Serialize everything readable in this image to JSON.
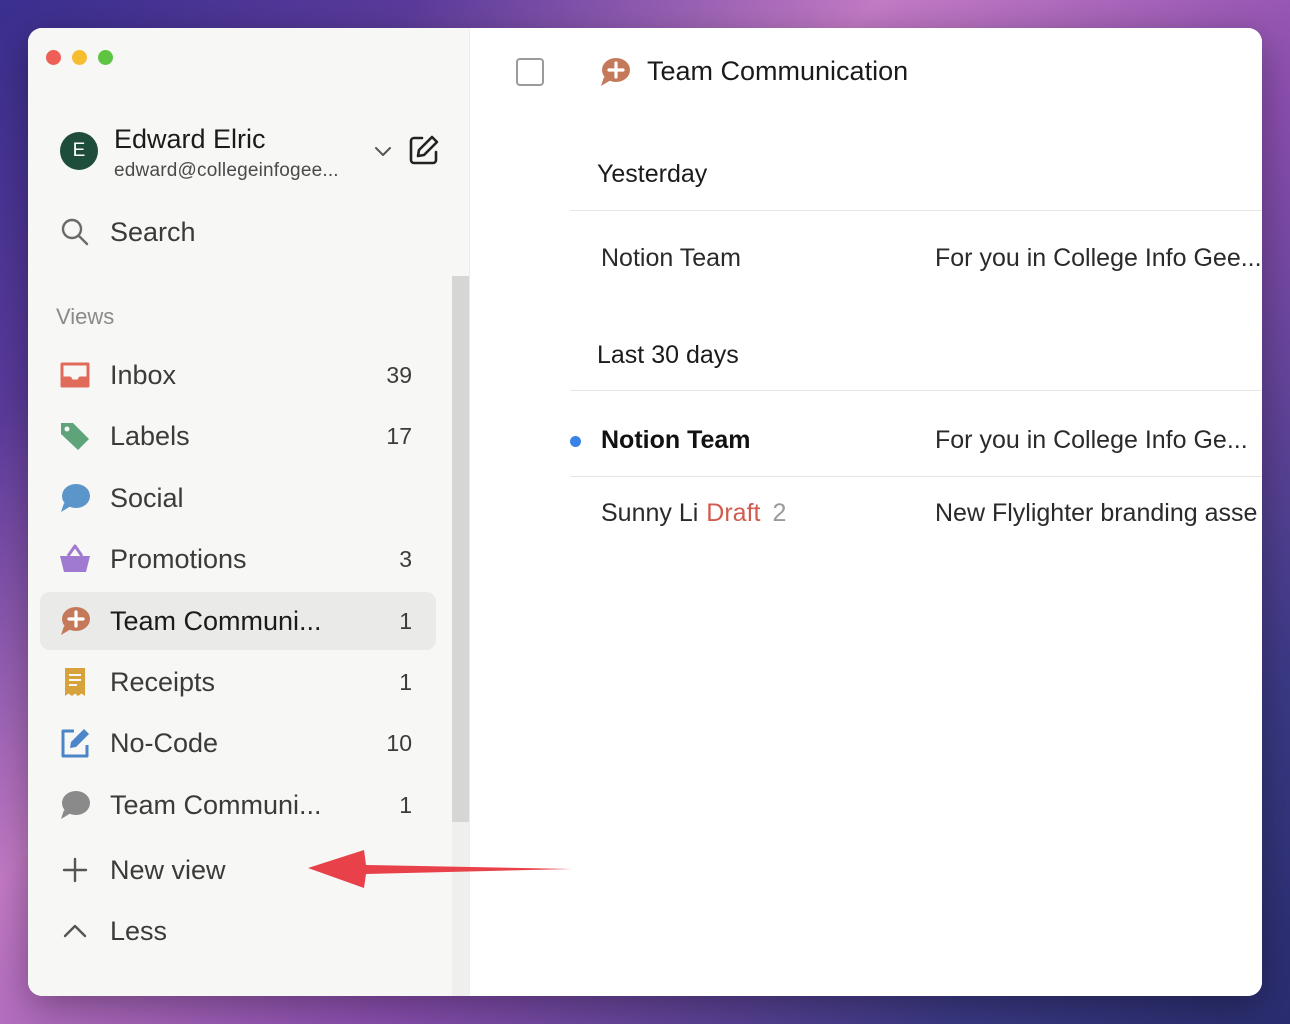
{
  "account": {
    "avatar_letter": "E",
    "name": "Edward Elric",
    "email": "edward@collegeinfogee..."
  },
  "search": {
    "label": "Search"
  },
  "sidebar": {
    "views_label": "Views",
    "items": [
      {
        "label": "Inbox",
        "count": "39",
        "icon": "inbox-icon",
        "color": "#e06b5a"
      },
      {
        "label": "Labels",
        "count": "17",
        "icon": "tag-icon",
        "color": "#5fa37a"
      },
      {
        "label": "Social",
        "count": "",
        "icon": "speech-bubble-icon",
        "color": "#5b95c9"
      },
      {
        "label": "Promotions",
        "count": "3",
        "icon": "basket-icon",
        "color": "#a07ad0"
      },
      {
        "label": "Team Communi...",
        "count": "1",
        "icon": "chat-plus-icon",
        "color": "#c47a5a",
        "active": true
      },
      {
        "label": "Receipts",
        "count": "1",
        "icon": "receipt-icon",
        "color": "#d8a23b"
      },
      {
        "label": "No-Code",
        "count": "10",
        "icon": "edit-square-icon",
        "color": "#4a86c8"
      },
      {
        "label": "Team Communi...",
        "count": "1",
        "icon": "speech-bubble-gray-icon",
        "color": "#8a8a8a"
      }
    ],
    "new_view_label": "New view",
    "less_label": "Less"
  },
  "main": {
    "title": "Team Communication",
    "sections": [
      {
        "heading": "Yesterday",
        "rows": [
          {
            "sender": "Notion Team",
            "subject": "For you in College Info Gee...",
            "unread": false
          }
        ]
      },
      {
        "heading": "Last 30 days",
        "rows": [
          {
            "sender": "Notion Team",
            "subject": "For you in College Info Ge...",
            "unread": true
          },
          {
            "sender": "Sunny Li",
            "draft": "Draft",
            "thread_count": "2",
            "subject": "New Flylighter branding asse",
            "unread": false
          }
        ]
      }
    ]
  },
  "colors": {
    "accent_blue": "#3b82e8",
    "draft_red": "#d05b4f",
    "annotation_arrow": "#e8414a"
  }
}
